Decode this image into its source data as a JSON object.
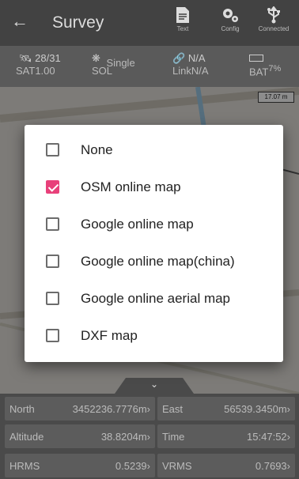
{
  "header": {
    "title": "Survey",
    "tools": [
      {
        "label": "Text",
        "icon": "document-icon"
      },
      {
        "label": "Config",
        "icon": "gears-icon"
      },
      {
        "label": "Connected",
        "icon": "usb-icon"
      }
    ]
  },
  "status": {
    "sat_count": "28/31",
    "sat_label": "SAT1.00",
    "sol_mode": "Single",
    "sol_label": "SOL",
    "link_top": "N/A",
    "link_label": "LinkN/A",
    "bat_value": "7%",
    "bat_label": "BAT"
  },
  "map": {
    "scale_text": "17.07 m"
  },
  "dialog": {
    "options": [
      {
        "label": "None",
        "checked": false
      },
      {
        "label": "OSM online map",
        "checked": true
      },
      {
        "label": "Google online map",
        "checked": false
      },
      {
        "label": "Google online map(china)",
        "checked": false
      },
      {
        "label": "Google online aerial map",
        "checked": false
      },
      {
        "label": "DXF map",
        "checked": false
      }
    ]
  },
  "readouts": {
    "north": {
      "label": "North",
      "value": "3452236.7776m"
    },
    "east": {
      "label": "East",
      "value": "56539.3450m"
    },
    "altitude": {
      "label": "Altitude",
      "value": "38.8204m"
    },
    "time": {
      "label": "Time",
      "value": "15:47:52"
    },
    "hrms": {
      "label": "HRMS",
      "value": "0.5239"
    },
    "vrms": {
      "label": "VRMS",
      "value": "0.7693"
    }
  },
  "colors": {
    "accent": "#e8407a",
    "topbar": "#424242",
    "statusbar": "#5a5a5a"
  }
}
